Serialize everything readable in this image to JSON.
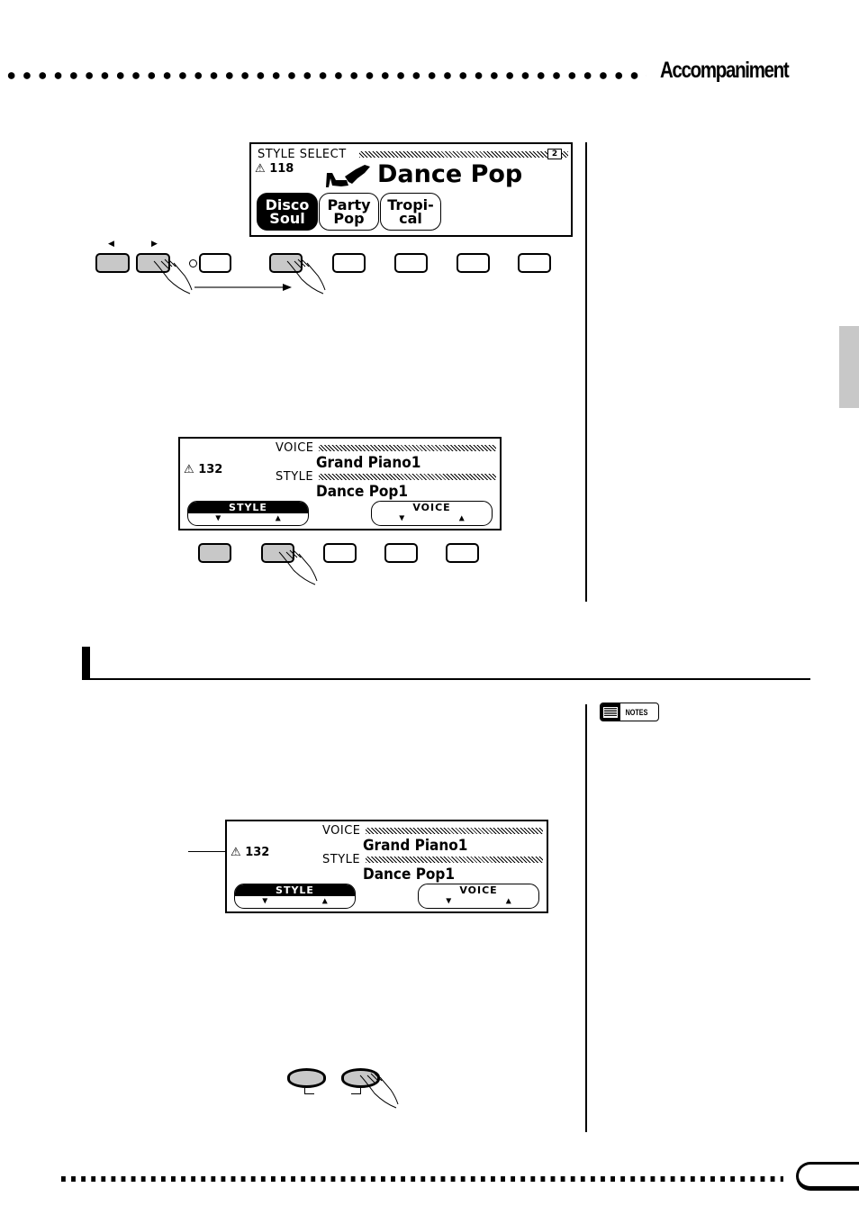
{
  "header": {
    "chapter_title": "Accompaniment"
  },
  "lcd_style_select": {
    "title": "STYLE SELECT",
    "page_indicator": "2",
    "tempo_icon": "metronome-icon",
    "tempo": "118",
    "category_icon": "dance-shoes-icon",
    "category_name": "Dance Pop",
    "styles": [
      {
        "line1": "Disco",
        "line2": "Soul",
        "selected": true
      },
      {
        "line1": "Party",
        "line2": "Pop",
        "selected": false
      },
      {
        "line1": "Tropi-",
        "line2": "cal",
        "selected": false
      }
    ]
  },
  "panel_buttons_top": {
    "page_left_arrow": "◀",
    "page_right_arrow": "▶",
    "buttons": [
      {
        "pressed": false
      },
      {
        "pressed": true
      },
      {
        "pressed": false
      },
      {
        "pressed": true
      },
      {
        "pressed": false
      },
      {
        "pressed": false
      },
      {
        "pressed": false
      },
      {
        "pressed": false
      }
    ]
  },
  "lcd_main_1": {
    "voice_label": "VOICE",
    "voice_name": "Grand Piano1",
    "style_label": "STYLE",
    "style_name": "Dance Pop1",
    "tempo": "132",
    "soft_buttons": [
      {
        "label": "STYLE",
        "down": "▼",
        "up": "▲",
        "selected": true
      },
      {
        "label": "VOICE",
        "down": "▼",
        "up": "▲",
        "selected": false
      }
    ]
  },
  "lcd_main_2": {
    "voice_label": "VOICE",
    "voice_name": "Grand Piano1",
    "style_label": "STYLE",
    "style_name": "Dance Pop1",
    "tempo": "132",
    "soft_buttons": [
      {
        "label": "STYLE",
        "down": "▼",
        "up": "▲",
        "selected": true
      },
      {
        "label": "VOICE",
        "down": "▼",
        "up": "▲",
        "selected": false
      }
    ]
  },
  "sidebar": {
    "notes_label": "NOTES"
  }
}
